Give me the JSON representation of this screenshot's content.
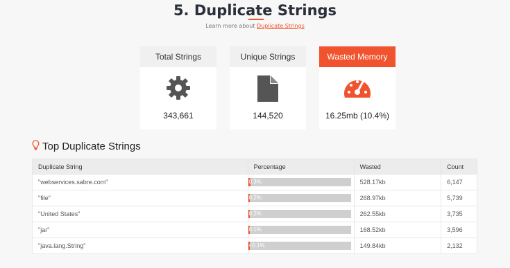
{
  "page": {
    "title": "5. Duplicate Strings",
    "learn_more_prefix": "Learn more about ",
    "learn_more_link": "Duplicate Strings"
  },
  "cards": [
    {
      "label": "Total Strings",
      "value": "343,661",
      "icon": "gear-icon"
    },
    {
      "label": "Unique Strings",
      "value": "144,520",
      "icon": "file-icon"
    },
    {
      "label": "Wasted Memory",
      "value": "16.25mb (10.4%)",
      "icon": "gauge-icon"
    }
  ],
  "section": {
    "title": "Top Duplicate Strings",
    "icon": "lightbulb-icon"
  },
  "table": {
    "headers": [
      "Duplicate String",
      "Percentage",
      "Wasted",
      "Count"
    ],
    "rows": [
      {
        "string": "\"webservices.sabre.com\"",
        "percentage": "0.3%",
        "percent_value": 0.3,
        "wasted": "528.17kb",
        "count": "6,147"
      },
      {
        "string": "\"file\"",
        "percentage": "0.2%",
        "percent_value": 0.2,
        "wasted": "268.97kb",
        "count": "5,739"
      },
      {
        "string": "\"United States\"",
        "percentage": "0.2%",
        "percent_value": 0.2,
        "wasted": "262.55kb",
        "count": "3,735"
      },
      {
        "string": "\"jar\"",
        "percentage": "0.1%",
        "percent_value": 0.1,
        "wasted": "168.52kb",
        "count": "3,596"
      },
      {
        "string": "\"java.lang.String\"",
        "percentage": "<0.1%",
        "percent_value": 0.05,
        "wasted": "149.84kb",
        "count": "2,132"
      }
    ]
  },
  "colors": {
    "accent": "#f0542f",
    "icon": "#555555"
  }
}
